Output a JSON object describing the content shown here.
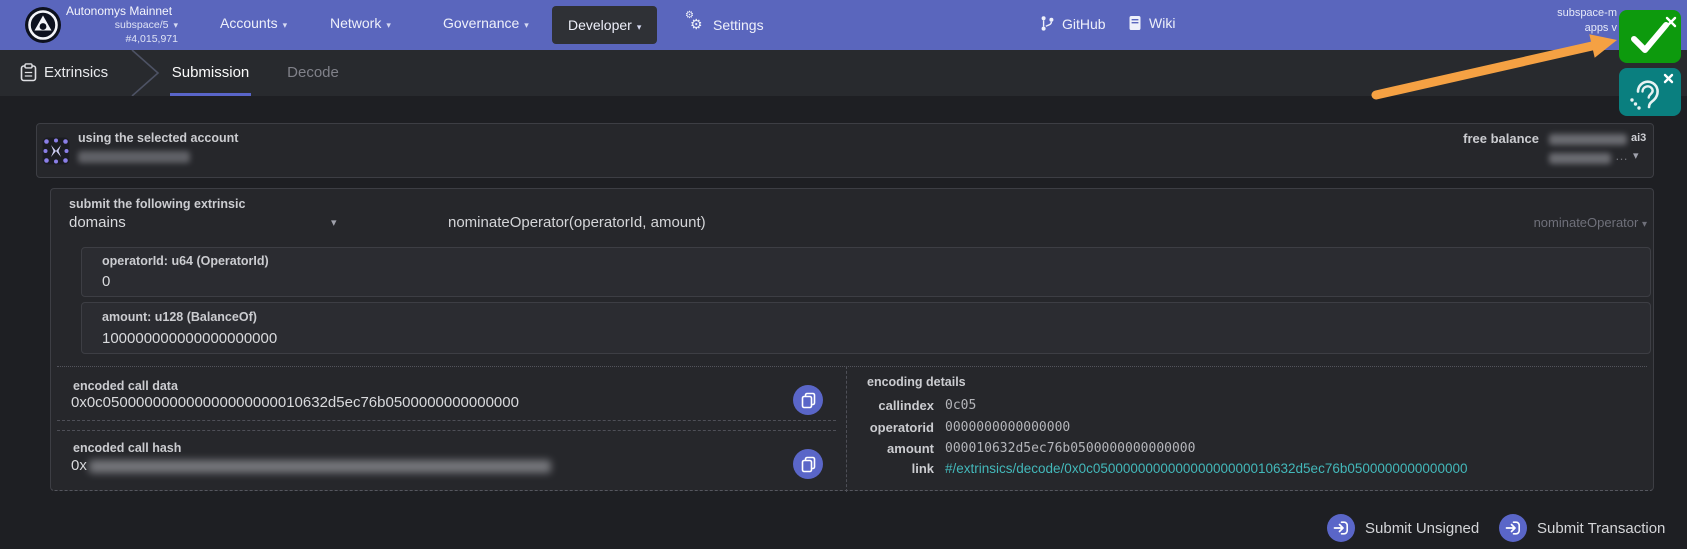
{
  "colors": {
    "navbar": "#5a66bd",
    "accent": "#5a66c8",
    "tab_underline": "#5965c9",
    "link": "#43b8ba",
    "approve_green": "#0d9a0d",
    "accessibility_teal": "#0a7f7f",
    "arrow_orange": "#f5a143"
  },
  "glyphs": {
    "caret": "▾",
    "ellipsis": "…",
    "gear": "⚙"
  },
  "icons": {
    "logo": "autonomys-logo",
    "extrinsics": "clipboard-icon",
    "settings": "gears-icon",
    "github": "git-branch-icon",
    "wiki": "book-icon",
    "copy": "copy-icon",
    "submit": "sign-in-icon",
    "approve": "check-icon",
    "accessibility": "ear-icon",
    "dropdown": "caret-down-icon",
    "identicon": "account-identicon"
  },
  "navbar": {
    "chain_name": "Autonomys Mainnet",
    "runtime": "subspace/5",
    "block_number": "#4,015,971",
    "menu": [
      {
        "label": "Accounts"
      },
      {
        "label": "Network"
      },
      {
        "label": "Governance"
      },
      {
        "label": "Developer"
      },
      {
        "label": "Settings"
      }
    ],
    "links": [
      {
        "label": "GitHub"
      },
      {
        "label": "Wiki"
      }
    ],
    "corner_line1": "subspace-m",
    "corner_line2": "apps v"
  },
  "tabbar": {
    "section": "Extrinsics",
    "tabs": [
      {
        "label": "Submission"
      },
      {
        "label": "Decode"
      }
    ]
  },
  "account": {
    "label": "using the selected account",
    "free_balance_label": "free balance",
    "balance_unit": "ai3"
  },
  "extrinsic": {
    "section_label": "submit the following extrinsic",
    "pallet": "domains",
    "method_signature": "nominateOperator(operatorId, amount)",
    "method_selected": "nominateOperator",
    "params": [
      {
        "label": "operatorId: u64 (OperatorId)",
        "value": "0"
      },
      {
        "label": "amount: u128 (BalanceOf)",
        "value": "100000000000000000000"
      }
    ]
  },
  "output": {
    "call_data_label": "encoded call data",
    "call_data": "0x0c050000000000000000000010632d5ec76b0500000000000000",
    "call_hash_label": "encoded call hash",
    "call_hash_prefix": "0x",
    "details_label": "encoding details",
    "details": [
      {
        "key": "callindex",
        "value": "0c05"
      },
      {
        "key": "operatorid",
        "value": "0000000000000000"
      },
      {
        "key": "amount",
        "value": "000010632d5ec76b0500000000000000"
      },
      {
        "key": "link",
        "value": "#/extrinsics/decode/0x0c050000000000000000000010632d5ec76b0500000000000000"
      }
    ]
  },
  "actions": [
    {
      "label": "Submit Unsigned"
    },
    {
      "label": "Submit Transaction"
    }
  ]
}
